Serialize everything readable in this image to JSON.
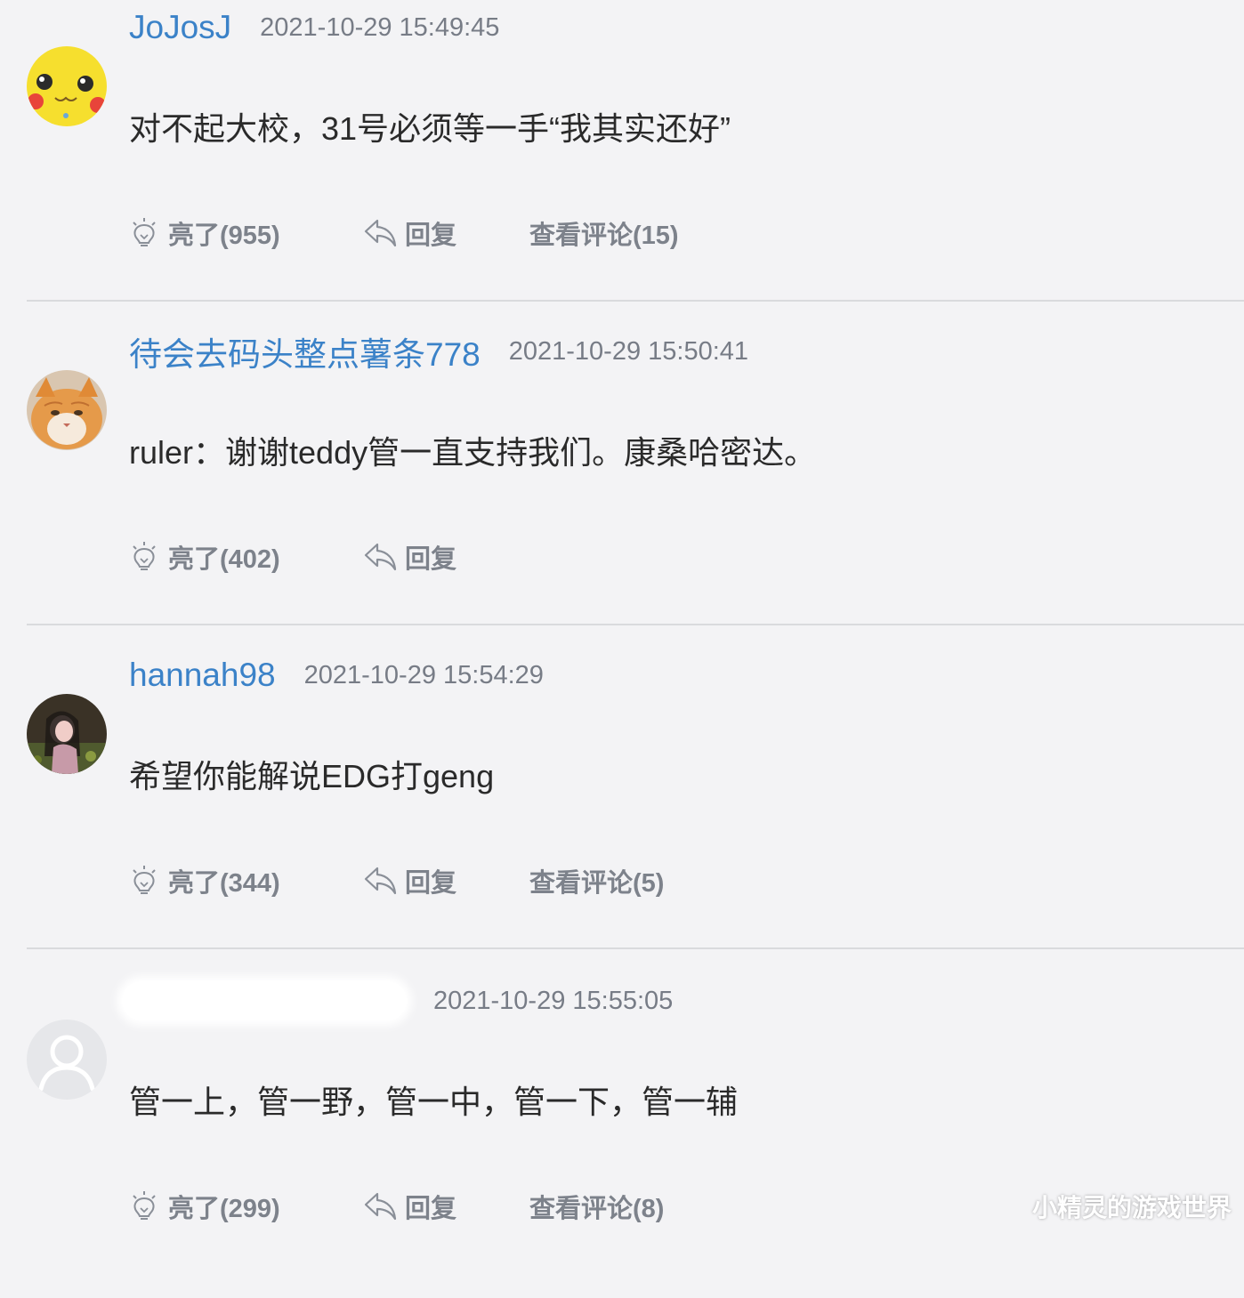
{
  "comments": [
    {
      "username": "JoJosJ",
      "timestamp": "2021-10-29 15:49:45",
      "text": "对不起大校，31号必须等一手“我其实还好”",
      "like_label": "亮了(955)",
      "reply_label": "回复",
      "view_label": "查看评论(15)",
      "avatar_icon": "pikachu-avatar"
    },
    {
      "username": "待会去码头整点薯条778",
      "timestamp": "2021-10-29 15:50:41",
      "text": "ruler：谢谢teddy管一直支持我们。康桑哈密达。",
      "like_label": "亮了(402)",
      "reply_label": "回复",
      "avatar_icon": "cat-avatar"
    },
    {
      "username": "hannah98",
      "timestamp": "2021-10-29 15:54:29",
      "text": "希望你能解说EDG打geng",
      "like_label": "亮了(344)",
      "reply_label": "回复",
      "view_label": "查看评论(5)",
      "avatar_icon": "photo-avatar"
    },
    {
      "username": "",
      "timestamp": "2021-10-29 15:55:05",
      "text": "管一上，管一野，管一中，管一下，管一辅",
      "like_label": "亮了(299)",
      "reply_label": "回复",
      "view_label": "查看评论(8)",
      "avatar_icon": "default-user-avatar"
    }
  ],
  "watermark": "小精灵的游戏世界",
  "colors": {
    "background": "#f3f3f5",
    "username": "#3b82c8",
    "timestamp": "#777c86",
    "action_text": "#7d828b",
    "content_text": "#2a2a2a"
  }
}
